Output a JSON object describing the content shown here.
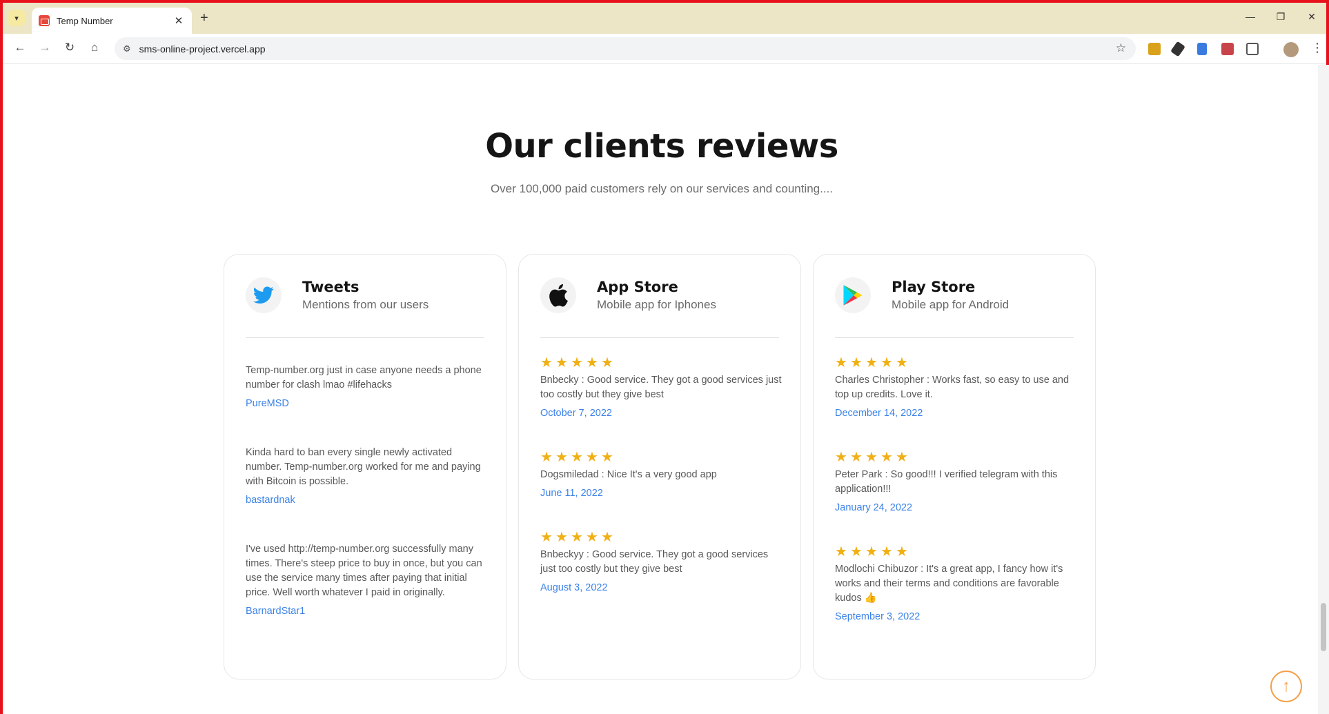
{
  "browser": {
    "tab_title": "Temp Number",
    "url": "sms-online-project.vercel.app"
  },
  "section": {
    "title": "Our clients reviews",
    "subtitle": "Over 100,000 paid customers rely on our services and counting...."
  },
  "cards": [
    {
      "title": "Tweets",
      "subtitle": "Mentions from our users",
      "icon": "twitter-bird-icon",
      "reviews": [
        {
          "text": "Temp-number.org just in case anyone needs a phone number for clash lmao #lifehacks",
          "meta": "PureMSD"
        },
        {
          "text": "Kinda hard to ban every single newly activated number. Temp-number.org worked for me and paying with Bitcoin is possible.",
          "meta": "bastardnak"
        },
        {
          "text": "I've used http://temp-number.org successfully many times. There's steep price to buy in once, but you can use the service many times after paying that initial price. Well worth whatever I paid in originally.",
          "meta": "BarnardStar1"
        }
      ]
    },
    {
      "title": "App Store",
      "subtitle": "Mobile app for Iphones",
      "icon": "apple-icon",
      "reviews": [
        {
          "rating": 5,
          "text": "Bnbecky : Good service. They got a good services just too costly but they give best",
          "meta": "October 7, 2022"
        },
        {
          "rating": 5,
          "text": "Dogsmiledad : Nice It's a very good app",
          "meta": "June 11, 2022"
        },
        {
          "rating": 5,
          "text": "Bnbeckyy : Good service. They got a good services just too costly but they give best",
          "meta": "August 3, 2022"
        }
      ]
    },
    {
      "title": "Play Store",
      "subtitle": "Mobile app for Android",
      "icon": "google-play-icon",
      "reviews": [
        {
          "rating": 5,
          "text": "Charles Christopher : Works fast, so easy to use and top up credits. Love it.",
          "meta": "December 14, 2022"
        },
        {
          "rating": 5,
          "text": "Peter Park : So good!!! I verified telegram with this application!!!",
          "meta": "January 24, 2022"
        },
        {
          "rating": 5,
          "text": "Modlochi Chibuzor : It's a great app, I fancy how it's works and their terms and conditions are favorable kudos 👍",
          "meta": "September 3, 2022"
        }
      ]
    }
  ],
  "colors": {
    "accent_link": "#3b82e8",
    "star": "#f0b014",
    "back_to_top": "#f4a04a"
  }
}
